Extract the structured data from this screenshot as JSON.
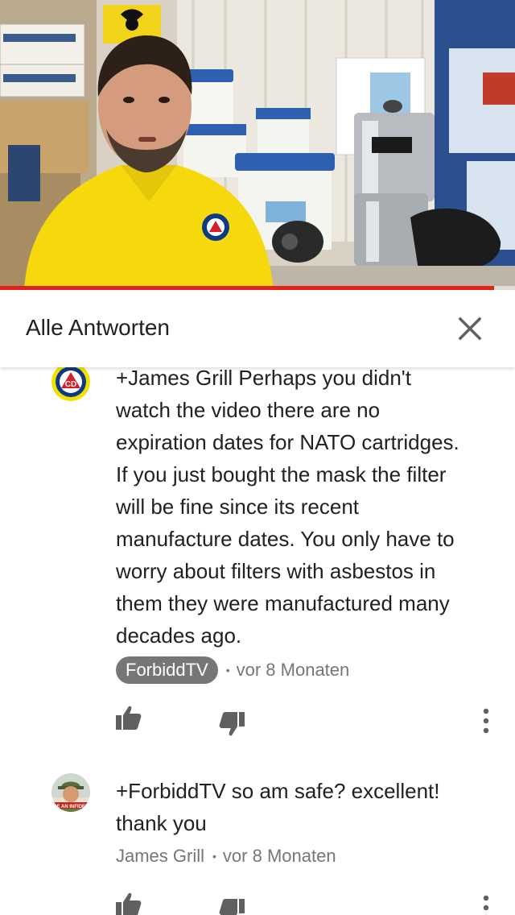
{
  "video": {
    "progress_fraction": 0.96,
    "accent_color": "#e62117"
  },
  "replies_panel": {
    "title": "Alle Antworten",
    "close_icon": "close-icon"
  },
  "comments": [
    {
      "text": "+James Grill  Perhaps you didn't\nwatch the video there are no\nexpiration dates for NATO cartridges.\nIf you just bought the mask the filter\nwill be fine since its recent\nmanufacture dates. You only have to\nworry about filters with asbestos in\nthem they were manufactured many\ndecades ago.",
      "author": "ForbiddTV",
      "author_is_owner": true,
      "separator": "•",
      "time": "vor 8 Monaten",
      "avatar_icon": "civil-defense-logo-icon"
    },
    {
      "text": "+ForbiddTV so am safe? excellent!\nthank you",
      "author": "James Grill",
      "author_is_owner": false,
      "separator": "•",
      "time": "vor 8 Monaten",
      "avatar_icon": "user-avatar-icon"
    }
  ]
}
